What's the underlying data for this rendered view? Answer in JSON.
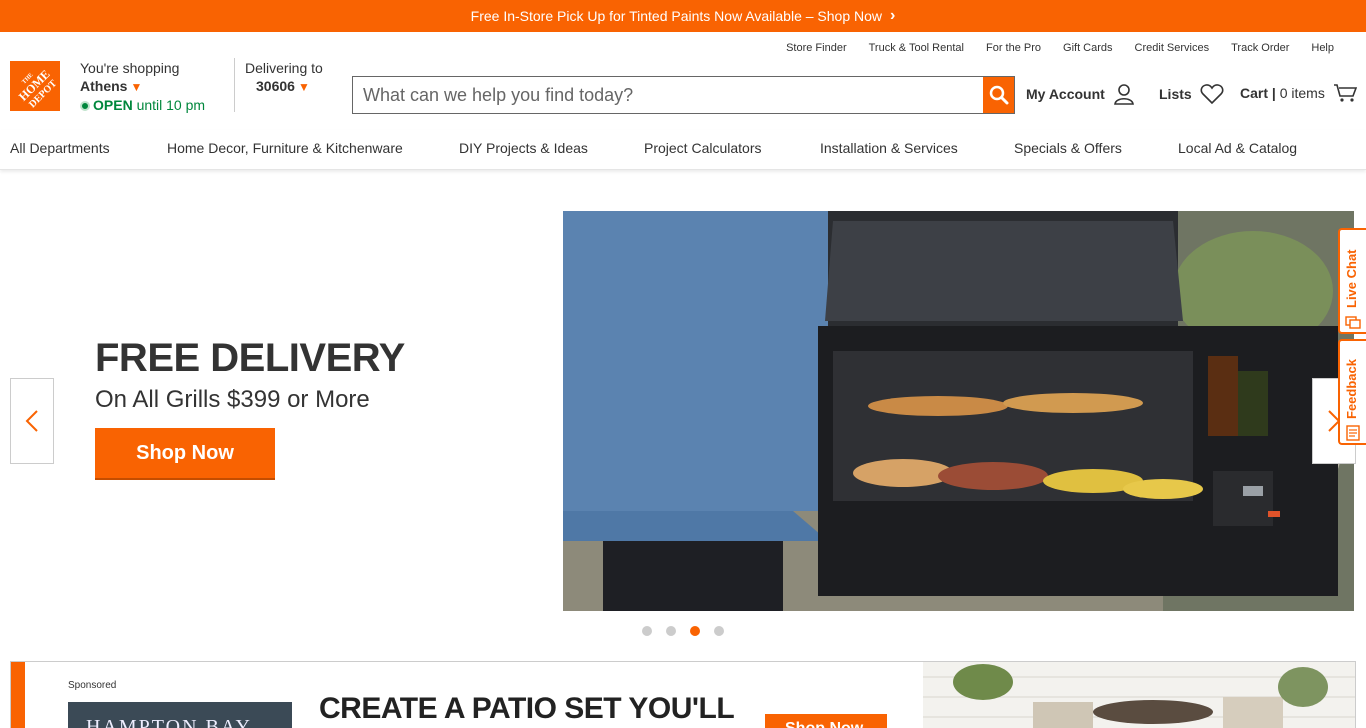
{
  "promo": {
    "text": "Free In-Store Pick Up for Tinted Paints Now Available – Shop Now",
    "chevron": "›"
  },
  "utility_links": [
    "Store Finder",
    "Truck & Tool Rental",
    "For the Pro",
    "Gift Cards",
    "Credit Services",
    "Track Order",
    "Help"
  ],
  "logo": {
    "text": "THE HOME DEPOT"
  },
  "store": {
    "label": "You're shopping",
    "city": "Athens",
    "status": "OPEN",
    "hours": "until 10 pm"
  },
  "delivery": {
    "label": "Delivering to",
    "zip": "30606"
  },
  "search": {
    "placeholder": "What can we help you find today?"
  },
  "account": {
    "label": "My Account"
  },
  "lists": {
    "label": "Lists"
  },
  "cart": {
    "label": "Cart",
    "items": "0 items"
  },
  "nav": [
    "All Departments",
    "Home Decor, Furniture & Kitchenware",
    "DIY Projects & Ideas",
    "Project Calculators",
    "Installation & Services",
    "Specials & Offers",
    "Local Ad & Catalog"
  ],
  "hero": {
    "title": "FREE DELIVERY",
    "subtitle": "On All Grills $399 or More",
    "cta": "Shop Now",
    "carousel_active_index": 3,
    "carousel_count": 4
  },
  "side_tabs": {
    "chat": "Live Chat",
    "feedback": "Feedback"
  },
  "sponsored": {
    "label": "Sponsored",
    "brand": "HAMPTON BAY",
    "headline": "CREATE A PATIO SET YOU'LL",
    "cta": "Shop Now"
  },
  "colors": {
    "brand": "#f96302",
    "open": "#00873c"
  }
}
